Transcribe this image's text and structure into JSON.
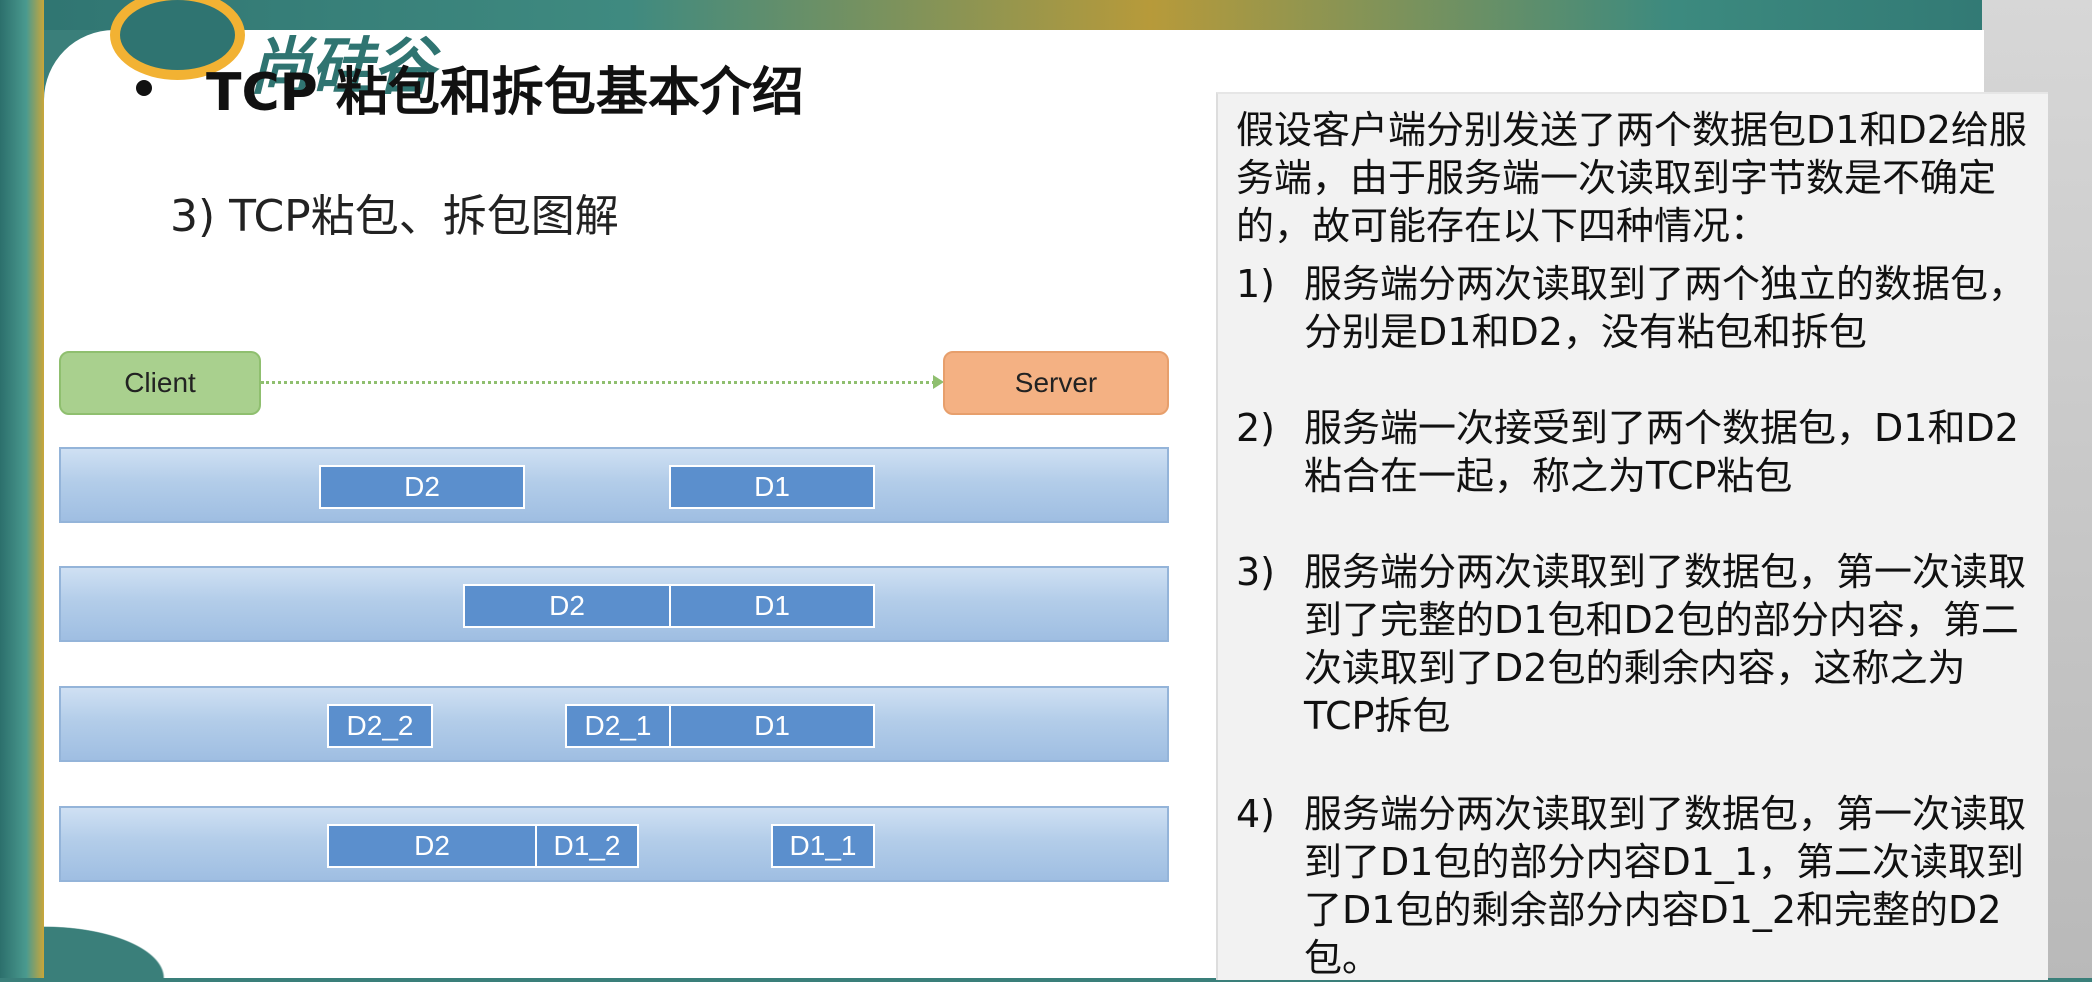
{
  "slide": {
    "logo_text": "尚硅谷",
    "title": "TCP 粘包和拆包基本介绍",
    "subtitle": "3)  TCP粘包、拆包图解"
  },
  "diagram": {
    "client_label": "Client",
    "server_label": "Server",
    "rows": [
      {
        "packets": [
          "D2",
          "D1"
        ]
      },
      {
        "packets": [
          "D2",
          "D1"
        ]
      },
      {
        "packets": [
          "D2_2",
          "D2_1",
          "D1"
        ]
      },
      {
        "packets": [
          "D2",
          "D1_2",
          "D1_1"
        ]
      }
    ]
  },
  "explanation": {
    "intro": "假设客户端分别发送了两个数据包D1和D2给服务端，由于服务端一次读取到字节数是不确定的，故可能存在以下四种情况：",
    "cases": [
      {
        "num": "1)",
        "text": "服务端分两次读取到了两个独立的数据包，分别是D1和D2，没有粘包和拆包"
      },
      {
        "num": "2)",
        "text": "服务端一次接受到了两个数据包，D1和D2粘合在一起，称之为TCP粘包"
      },
      {
        "num": "3)",
        "text": "服务端分两次读取到了数据包，第一次读取到了完整的D1包和D2包的部分内容，第二次读取到了D2包的剩余内容，这称之为TCP拆包"
      },
      {
        "num": "4)",
        "text": "服务端分两次读取到了数据包，第一次读取到了D1包的部分内容D1_1，第二次读取到了D1包的剩余部分内容D1_2和完整的D2包。"
      }
    ]
  },
  "colors": {
    "client_fill": "#a9d08e",
    "server_fill": "#f4b183",
    "packet_fill": "#5b8fcd",
    "band_fill": "#b3cde9"
  }
}
